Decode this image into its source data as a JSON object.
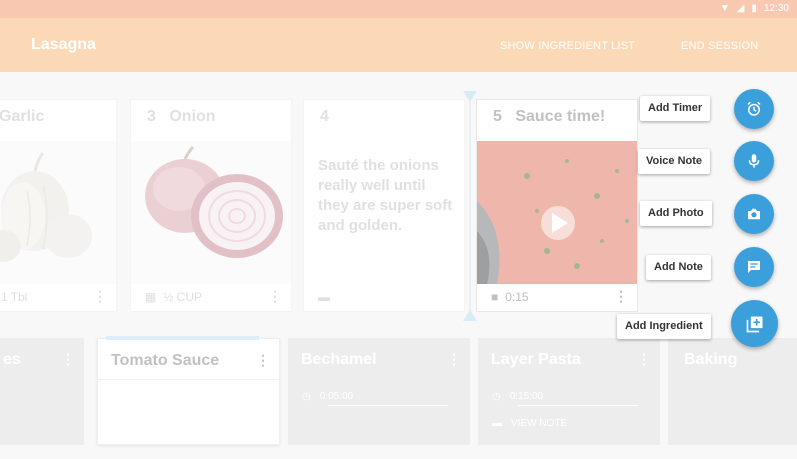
{
  "status_bar": {
    "time": "12:30",
    "icons": [
      "wifi-icon",
      "signal-icon",
      "battery-icon"
    ]
  },
  "app_bar": {
    "title": "Lasagna",
    "show_ingredient_list": "SHOW INGREDIENT LIST",
    "end_session": "END SESSION"
  },
  "steps": [
    {
      "num": "",
      "title": "Garlic",
      "foot_text": "1 Tbl",
      "foot_icon": "",
      "image": "garlic"
    },
    {
      "num": "3",
      "title": "Onion",
      "foot_text": "½ CUP",
      "foot_icon": "grid-icon",
      "image": "onion"
    },
    {
      "num": "4",
      "title": "",
      "text": "Sauté the onions really well until they are super soft and golden.",
      "foot_icon": "note-icon"
    },
    {
      "num": "5",
      "title": "Sauce time!",
      "foot_text": "0:15",
      "foot_icon": "video-icon",
      "image": "sauce"
    }
  ],
  "sections": [
    {
      "title": "es"
    },
    {
      "title": "Tomato Sauce",
      "active": true
    },
    {
      "title": "Bechamel",
      "timer": "0:05:00"
    },
    {
      "title": "Layer Pasta",
      "timer": "0:15:00",
      "note": "VIEW NOTE"
    },
    {
      "title": "Baking"
    }
  ],
  "fab_menu": [
    {
      "label": "Add Timer",
      "icon": "alarm-icon"
    },
    {
      "label": "Voice Note",
      "icon": "mic-icon"
    },
    {
      "label": "Add Photo",
      "icon": "camera-icon"
    },
    {
      "label": "Add Note",
      "icon": "comment-icon"
    },
    {
      "label": "Add Ingredient",
      "icon": "add-library-icon"
    }
  ],
  "colors": {
    "status_bar": "#f8c9b0",
    "app_bar": "#fbd9b7",
    "fab": "#3a9fdb",
    "accent_light": "#bfe1f4"
  }
}
